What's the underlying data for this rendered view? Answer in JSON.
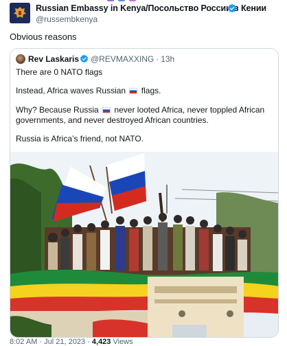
{
  "post": {
    "author_name": "Russian Embassy in Kenya/Посольство России в Кении",
    "author_handle": "@russembkenya",
    "text": "Obvious reasons"
  },
  "quote": {
    "author_name": "Rev Laskaris",
    "author_handle": "@REVMAXXING",
    "separator": "·",
    "time": "13h",
    "line1": "There are 0 NATO flags",
    "line2a": "Instead, Africa waves Russian",
    "line2b": "flags.",
    "line3a": "Why? Because Russia",
    "line3b": "never looted Africa, never toppled African",
    "line4": "governments, and never destroyed African countries.",
    "line5": "Russia is Africa’s friend, not NATO.",
    "image_icon": "crowd-photo-flags"
  },
  "meta": {
    "time": "8:02 AM",
    "separator": "·",
    "date": "Jul 21, 2023",
    "views_count": "4,423",
    "views_label": "Views"
  },
  "colors": {
    "verified": "#1d9bf0",
    "secondary_text": "#536471",
    "border": "#cfd9de"
  }
}
